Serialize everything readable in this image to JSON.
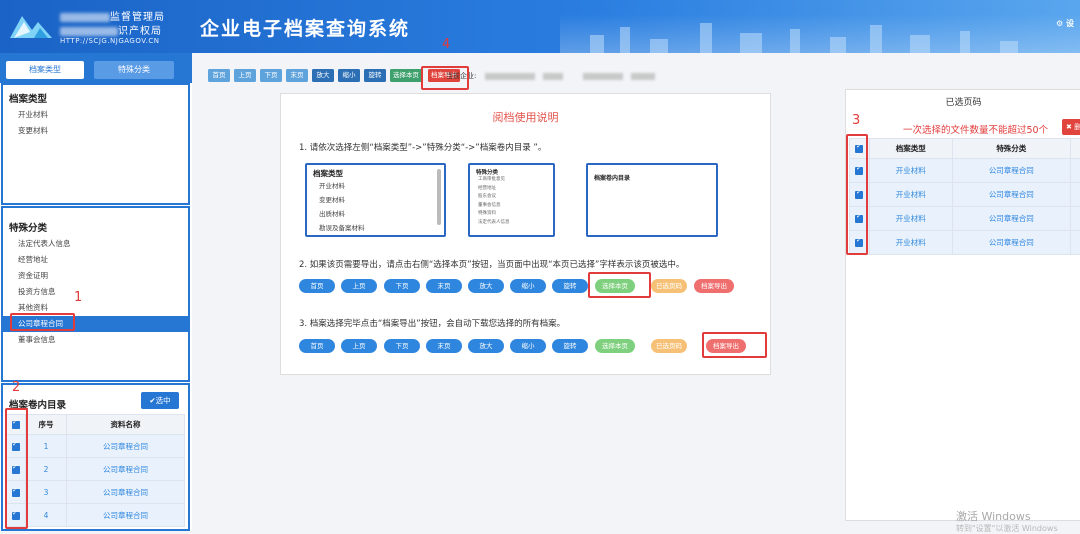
{
  "header": {
    "org_line1_suffix": "监督管理局",
    "org_line2_suffix": "识产权局",
    "org_url": "HTTP://SCJG.NJGAGOV.CN",
    "system_title": "企业电子档案查询系统",
    "settings_label": "设"
  },
  "sidebar": {
    "tabs": [
      "档案类型",
      "特殊分类"
    ],
    "archive_type": {
      "title": "档案类型",
      "items": [
        "开业材料",
        "变更材料"
      ]
    },
    "special": {
      "title": "特殊分类",
      "items": [
        "法定代表人信息",
        "经营地址",
        "资金证明",
        "投资方信息",
        "其他资料",
        "公司章程合同",
        "董事会信息"
      ],
      "selected": "公司章程合同"
    },
    "directory": {
      "title": "档案卷内目录",
      "select_button": "选中",
      "columns": [
        "序号",
        "资料名称"
      ],
      "rows": [
        {
          "no": "1",
          "name": "公司章程合同"
        },
        {
          "no": "2",
          "name": "公司章程合同"
        },
        {
          "no": "3",
          "name": "公司章程合同"
        },
        {
          "no": "4",
          "name": "公司章程合同"
        }
      ]
    }
  },
  "annotations": {
    "n1": "1",
    "n2": "2",
    "n3": "3",
    "n4": "4"
  },
  "toolbar": {
    "buttons": [
      "首页",
      "上页",
      "下页",
      "末页",
      "放大",
      "缩小",
      "旋转",
      "选择本页",
      "档案导出"
    ],
    "current_company_label": "当前企业:"
  },
  "instructions": {
    "title": "阅档使用说明",
    "step1": "1.    请依次选择左侧“档案类型”->”特殊分类“->”档案卷内目录 ”。",
    "step2": "2.    如果该页需要导出，请点击右侧“选择本页”按钮，当页面中出现“本页已选择”字样表示该页被选中。",
    "step3": "3.    档案选择完毕点击“档案导出”按钮，会自动下载您选择的所有档案。",
    "mini1": {
      "title": "档案类型",
      "items": [
        "开业材料",
        "变更材料",
        "出质材料",
        "勘误及备案材料"
      ]
    },
    "mini2": {
      "title": "特殊分类",
      "items": [
        "工商审批意见",
        "经营地址",
        "股东会议",
        "董事会信息",
        "特殊资料",
        "法定代表人信息"
      ]
    },
    "mini3": {
      "title": "档案卷内目录"
    },
    "pills": [
      "首页",
      "上页",
      "下页",
      "末页",
      "放大",
      "缩小",
      "旋转",
      "选择本页",
      "已选页码",
      "档案导出"
    ]
  },
  "selected_panel": {
    "title": "已选页码",
    "warning": "一次选择的文件数量不能超过50个",
    "delete_label": "✖ 删",
    "columns": [
      "档案类型",
      "特殊分类"
    ],
    "rows": [
      {
        "type": "开业材料",
        "cat": "公司章程合同"
      },
      {
        "type": "开业材料",
        "cat": "公司章程合同"
      },
      {
        "type": "开业材料",
        "cat": "公司章程合同"
      },
      {
        "type": "开业材料",
        "cat": "公司章程合同"
      }
    ]
  },
  "watermark": {
    "line1": "激活 Windows",
    "line2": "转到\"设置\"以激活 Windows"
  },
  "colors": {
    "primary": "#2676d4",
    "annotation_red": "#e23b3b",
    "pill_blue": "#2e86de",
    "pill_green": "#7ed07e",
    "pill_orange": "#f6c177",
    "pill_red": "#ef6f6f"
  }
}
